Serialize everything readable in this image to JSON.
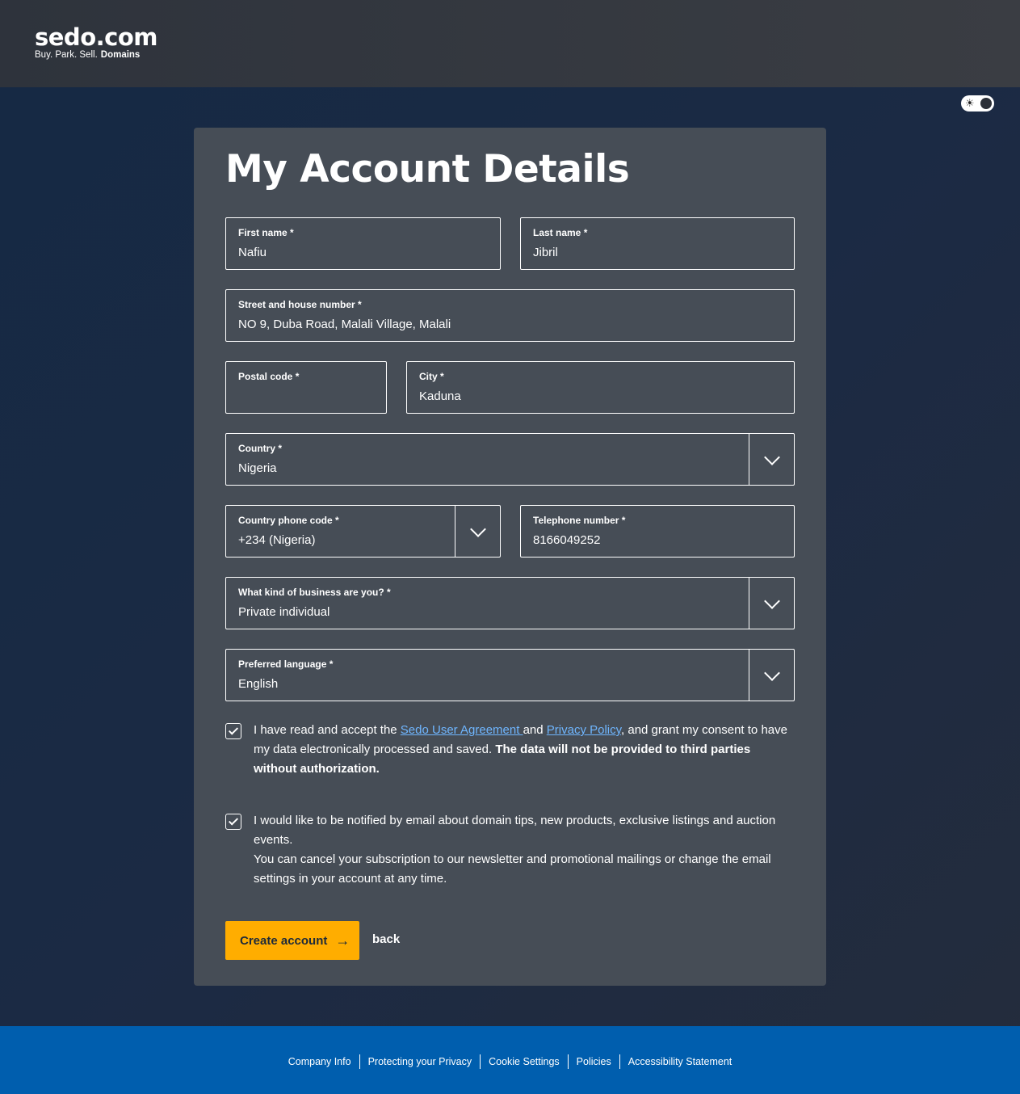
{
  "header": {
    "logo_main": "sedo.com",
    "logo_tag": "Buy.  Park.  Sell.",
    "logo_tag_bold": "Domains"
  },
  "theme_toggle": {
    "icon": "sun-icon",
    "state": "dark"
  },
  "form": {
    "title": "My Account Details",
    "first_name": {
      "label": "First name *",
      "value": "Nafiu"
    },
    "last_name": {
      "label": "Last name *",
      "value": "Jibril"
    },
    "street": {
      "label": "Street and house number *",
      "value": "NO 9, Duba Road, Malali Village, Malali"
    },
    "postal_code": {
      "label": "Postal code *",
      "value": ""
    },
    "city": {
      "label": "City *",
      "value": "Kaduna"
    },
    "country": {
      "label": "Country *",
      "value": "Nigeria"
    },
    "phone_code": {
      "label": "Country phone code *",
      "value": "+234 (Nigeria)"
    },
    "telephone": {
      "label": "Telephone number *",
      "value": "8166049252"
    },
    "business": {
      "label": "What kind of business are you? *",
      "value": "Private individual"
    },
    "language": {
      "label": "Preferred language *",
      "value": "English"
    },
    "agreement": {
      "checked": true,
      "text_1": "I have read and accept the ",
      "link_1": "Sedo User Agreement ",
      "text_2": "and ",
      "link_2": "Privacy Policy",
      "text_3": ", and grant my consent to have my data electronically processed and saved. ",
      "bold": "The data will not be provided to third parties without authorization."
    },
    "newsletter": {
      "checked": true,
      "line_1": "I would like to be notified by email about domain tips, new products, exclusive listings and auction events.",
      "line_2": "You can cancel your subscription to our newsletter and promotional mailings or change the email settings in your account at any time."
    },
    "create_label": "Create account",
    "back_label": "back"
  },
  "footer": {
    "links": [
      "Company Info",
      "Protecting your Privacy",
      "Cookie Settings",
      "Policies",
      "Accessibility Statement"
    ]
  },
  "colors": {
    "accent": "#ffad00",
    "footer": "#005eae",
    "card": "#464d56",
    "link": "#6fb6ff"
  }
}
